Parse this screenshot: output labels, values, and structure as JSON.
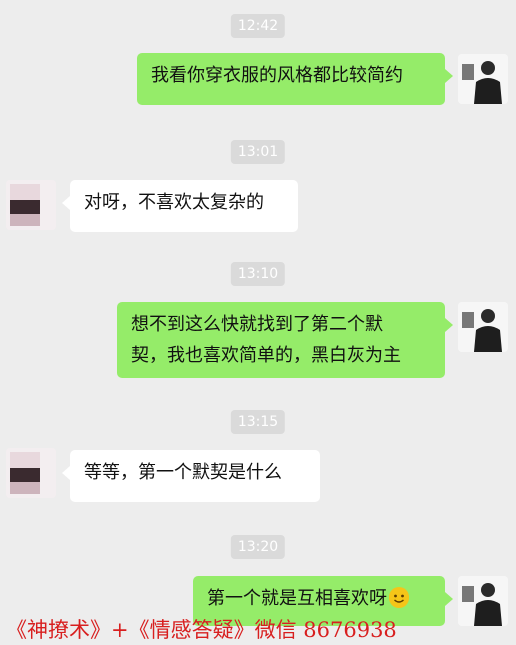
{
  "chat": {
    "messages": [
      {
        "time": "12:42",
        "sender": "me",
        "text": "我看你穿衣服的风格都比较简约"
      },
      {
        "time": "13:01",
        "sender": "other",
        "text": "对呀，不喜欢太复杂的"
      },
      {
        "time": "13:10",
        "sender": "me",
        "lines": [
          "想不到这么快就找到了第二个默",
          "契，我也喜欢简单的，黑白灰为主"
        ]
      },
      {
        "time": "13:15",
        "sender": "other",
        "text": "等等，第一个默契是什么"
      },
      {
        "time": "13:20",
        "sender": "me",
        "text": "第一个就是互相喜欢呀"
      }
    ]
  },
  "watermark": {
    "text": "《神撩术》+《情感答疑》微信 8676938"
  },
  "colors": {
    "background": "#ededed",
    "my_bubble": "#95ec69",
    "other_bubble": "#ffffff",
    "timestamp_bg": "#dadada",
    "watermark": "#d81f1f"
  },
  "icons": {
    "emoji": "smiling-face-emoji"
  }
}
